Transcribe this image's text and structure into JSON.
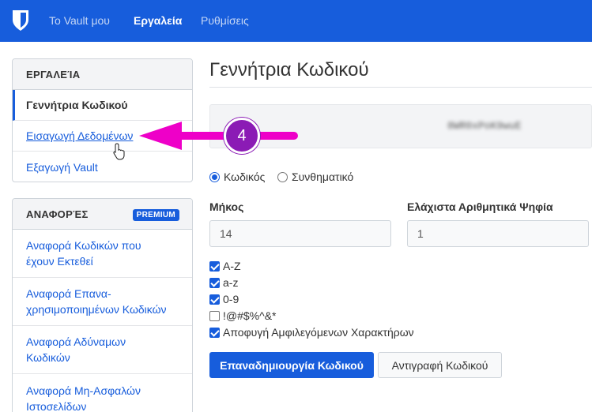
{
  "nav": {
    "items": [
      {
        "label": "Το Vault μου",
        "active": false
      },
      {
        "label": "Εργαλεία",
        "active": true
      },
      {
        "label": "Ρυθμίσεις",
        "active": false
      }
    ],
    "logo_icon": "shield-logo-icon"
  },
  "sidebar": {
    "tools": {
      "header": "ΕΡΓΑΛΕΊΑ",
      "items": [
        {
          "label": "Γεννήτρια Κωδικού",
          "active": true
        },
        {
          "label": "Εισαγωγή Δεδομένων",
          "active": false
        },
        {
          "label": "Εξαγωγή Vault",
          "active": false
        }
      ]
    },
    "reports": {
      "header": "ΑΝΑΦΟΡΈΣ",
      "badge": "PREMIUM",
      "items": [
        {
          "line1": "Αναφορά Κωδικών που",
          "line2": "έχουν Εκτεθεί"
        },
        {
          "line1": "Αναφορά Επανα-",
          "line2": "χρησιμοποιημένων Κωδικών"
        },
        {
          "line1": "Αναφορά Αδύναμων",
          "line2": "Κωδικών"
        },
        {
          "line1": "Αναφορά Μη-Ασφαλών",
          "line2": "Ιστοσελίδων"
        }
      ]
    }
  },
  "main": {
    "title": "Γεννήτρια Κωδικού",
    "generated_password": "8WR0xPoK9wuE",
    "type_options": [
      {
        "label": "Κωδικός",
        "checked": true
      },
      {
        "label": "Συνθηματικό",
        "checked": false
      }
    ],
    "length": {
      "label": "Μήκος",
      "value": "14"
    },
    "min_numbers": {
      "label": "Ελάχιστα Αριθμητικά Ψηφία",
      "value": "1"
    },
    "options": [
      {
        "label": "A-Z",
        "checked": true
      },
      {
        "label": "a-z",
        "checked": true
      },
      {
        "label": "0-9",
        "checked": true
      },
      {
        "label": "!@#$%^&*",
        "checked": false
      },
      {
        "label": "Αποφυγή Αμφιλεγόμενων Χαρακτήρων",
        "checked": true
      }
    ],
    "regenerate_label": "Επαναδημιουργία Κωδικού",
    "copy_label": "Αντιγραφή Κωδικού"
  },
  "annotation": {
    "step": "4",
    "arrow_color": "#ee00c8",
    "badge_color": "#8b1bb5"
  },
  "colors": {
    "brand": "#175ddc",
    "link": "#175ddc"
  }
}
